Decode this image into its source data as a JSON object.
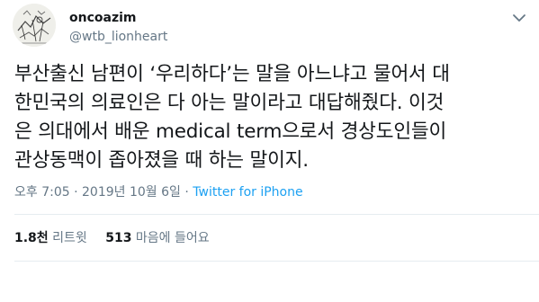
{
  "author": {
    "display_name": "oncoazim",
    "handle": "@wtb_lionheart",
    "avatar_icon": "sketch-artwork-avatar",
    "more_icon": "chevron-down-icon"
  },
  "tweet": {
    "lines": [
      "부산출신 남편이 ‘우리하다’는 말을 아느냐고 물어서 대",
      "한민국의 의료인은 다 아는 말이라고 대답해줬다. 이것",
      "은 의대에서 배운 medical term으로서 경상도인들이",
      "관상동맥이 좁아졌을 때 하는 말이지."
    ]
  },
  "meta": {
    "time": "오후 7:05",
    "separator1": " · ",
    "date": "2019년 10월 6일",
    "separator2": " · ",
    "source": "Twitter for iPhone"
  },
  "stats": {
    "retweets_count": "1.8천",
    "retweets_label": "리트윗",
    "likes_count": "513",
    "likes_label": "마음에 들어요"
  },
  "colors": {
    "text": "#14171a",
    "muted": "#657786",
    "accent": "#1da1f2",
    "border": "#e6ecf0"
  }
}
